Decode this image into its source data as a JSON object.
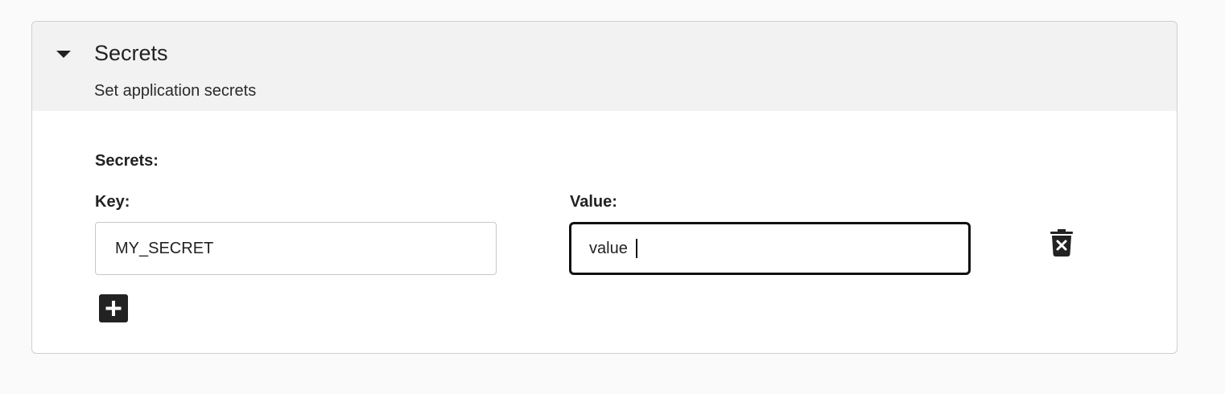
{
  "panel": {
    "title": "Secrets",
    "subtitle": "Set application secrets",
    "expanded": true,
    "toggle_icon": "caret-down-icon"
  },
  "form": {
    "section_label": "Secrets:",
    "key_label": "Key:",
    "value_label": "Value:",
    "rows": [
      {
        "key": "MY_SECRET",
        "value": "value "
      }
    ],
    "delete_icon": "trash-x-icon",
    "add_icon": "plus-square-icon"
  },
  "colors": {
    "header_bg": "#f2f2f2",
    "panel_border": "#cfcfcf",
    "focus_border": "#111111",
    "icon": "#222222"
  }
}
